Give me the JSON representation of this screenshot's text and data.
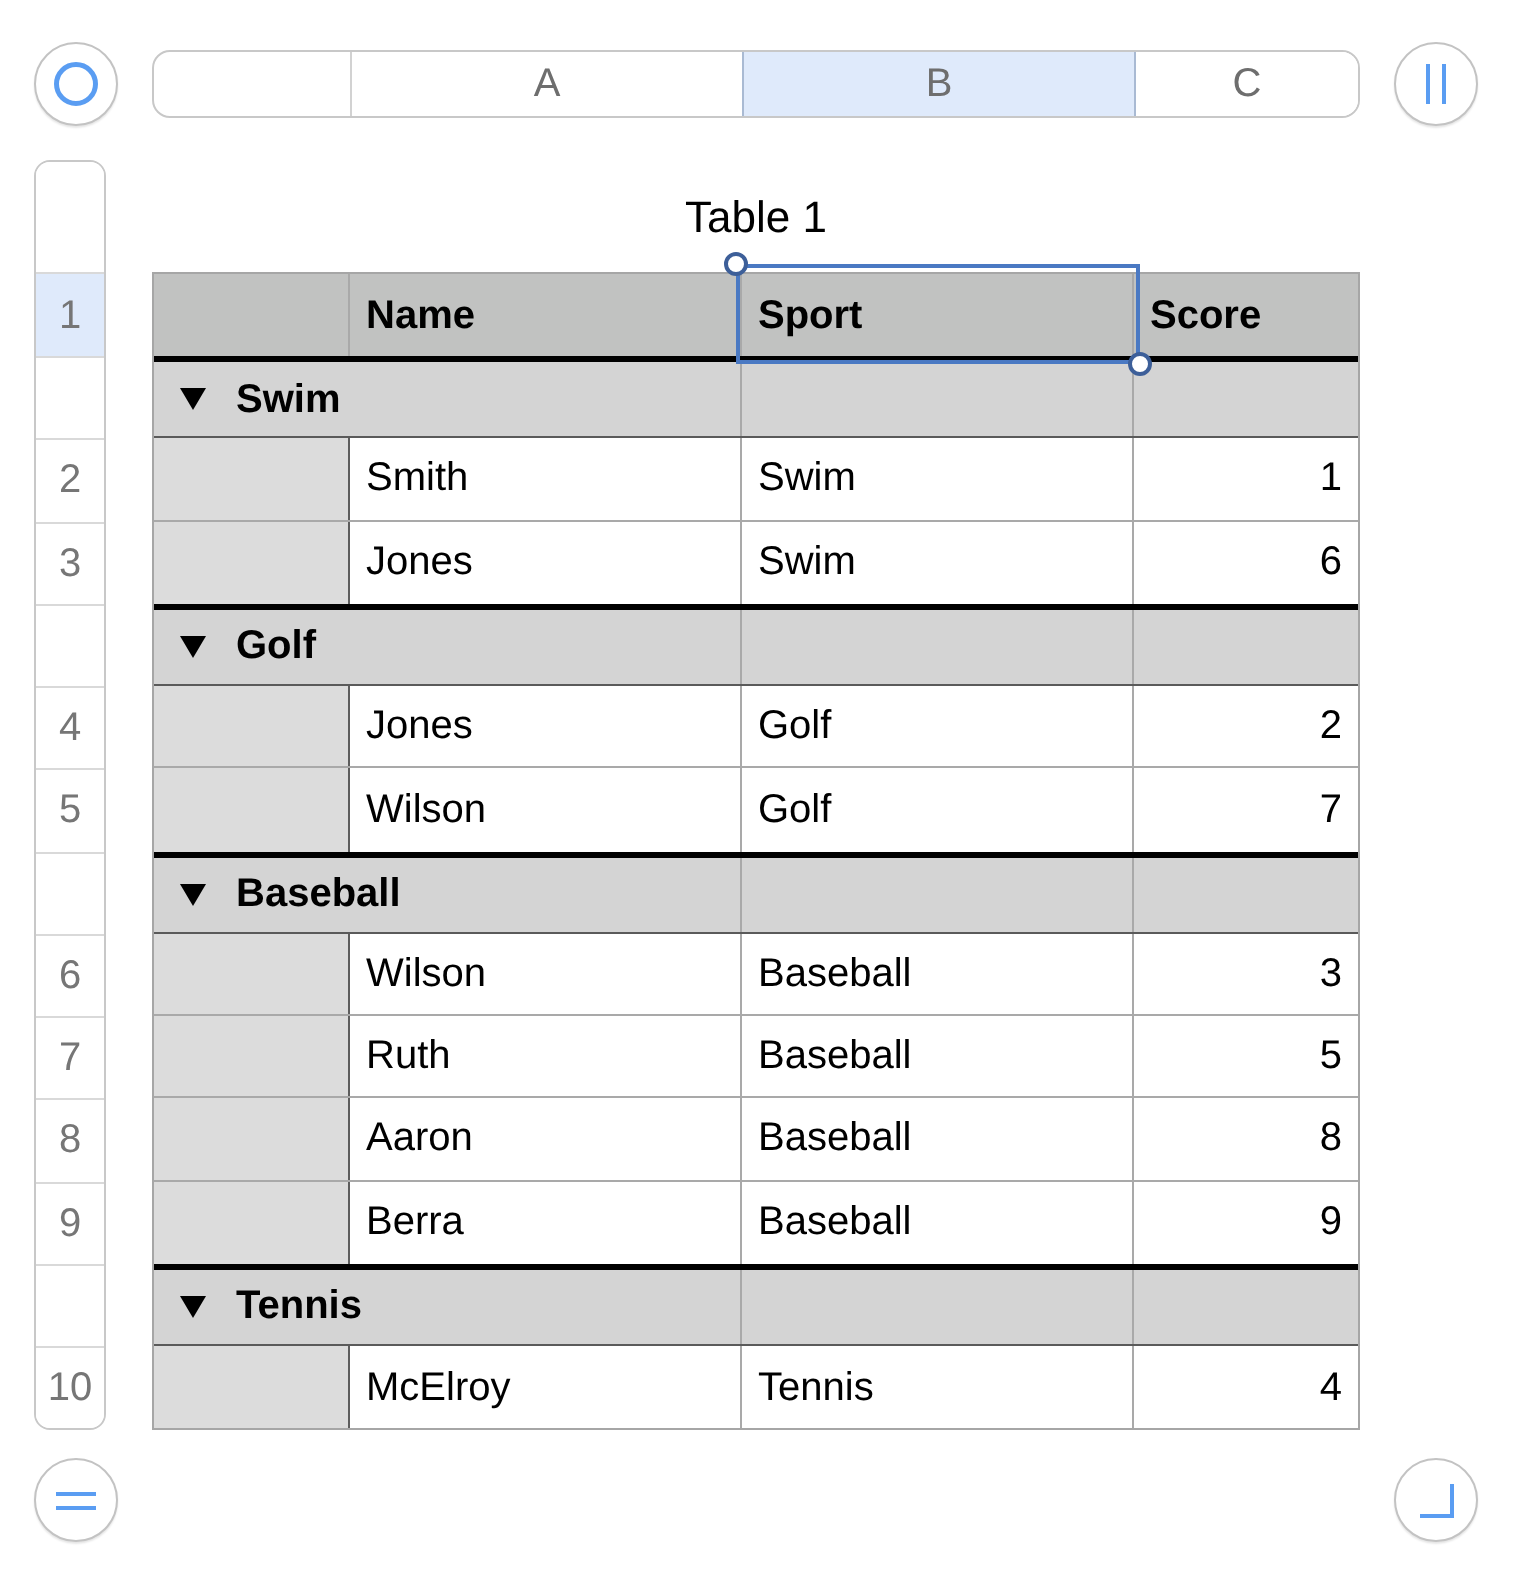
{
  "column_headers": [
    {
      "label": "A",
      "selected": false
    },
    {
      "label": "B",
      "selected": true
    },
    {
      "label": "C",
      "selected": false
    }
  ],
  "table": {
    "title": "Table 1",
    "header": {
      "row_number": "1",
      "selected": true,
      "cells": [
        {
          "text": "Name",
          "selected": false
        },
        {
          "text": "Sport",
          "selected": true
        },
        {
          "text": "Score",
          "selected": false
        }
      ]
    },
    "groups": [
      {
        "label": "Swim",
        "expanded": true,
        "rows": [
          {
            "row_number": "2",
            "selected": false,
            "cells": [
              "Smith",
              "Swim",
              "1"
            ]
          },
          {
            "row_number": "3",
            "selected": false,
            "cells": [
              "Jones",
              "Swim",
              "6"
            ]
          }
        ]
      },
      {
        "label": "Golf",
        "expanded": true,
        "rows": [
          {
            "row_number": "4",
            "selected": false,
            "cells": [
              "Jones",
              "Golf",
              "2"
            ]
          },
          {
            "row_number": "5",
            "selected": false,
            "cells": [
              "Wilson",
              "Golf",
              "7"
            ]
          }
        ]
      },
      {
        "label": "Baseball",
        "expanded": true,
        "rows": [
          {
            "row_number": "6",
            "selected": false,
            "cells": [
              "Wilson",
              "Baseball",
              "3"
            ]
          },
          {
            "row_number": "7",
            "selected": false,
            "cells": [
              "Ruth",
              "Baseball",
              "5"
            ]
          },
          {
            "row_number": "8",
            "selected": false,
            "cells": [
              "Aaron",
              "Baseball",
              "8"
            ]
          },
          {
            "row_number": "9",
            "selected": false,
            "cells": [
              "Berra",
              "Baseball",
              "9"
            ]
          }
        ]
      },
      {
        "label": "Tennis",
        "expanded": true,
        "rows": [
          {
            "row_number": "10",
            "selected": false,
            "cells": [
              "McElroy",
              "Tennis",
              "4"
            ]
          }
        ]
      }
    ]
  }
}
